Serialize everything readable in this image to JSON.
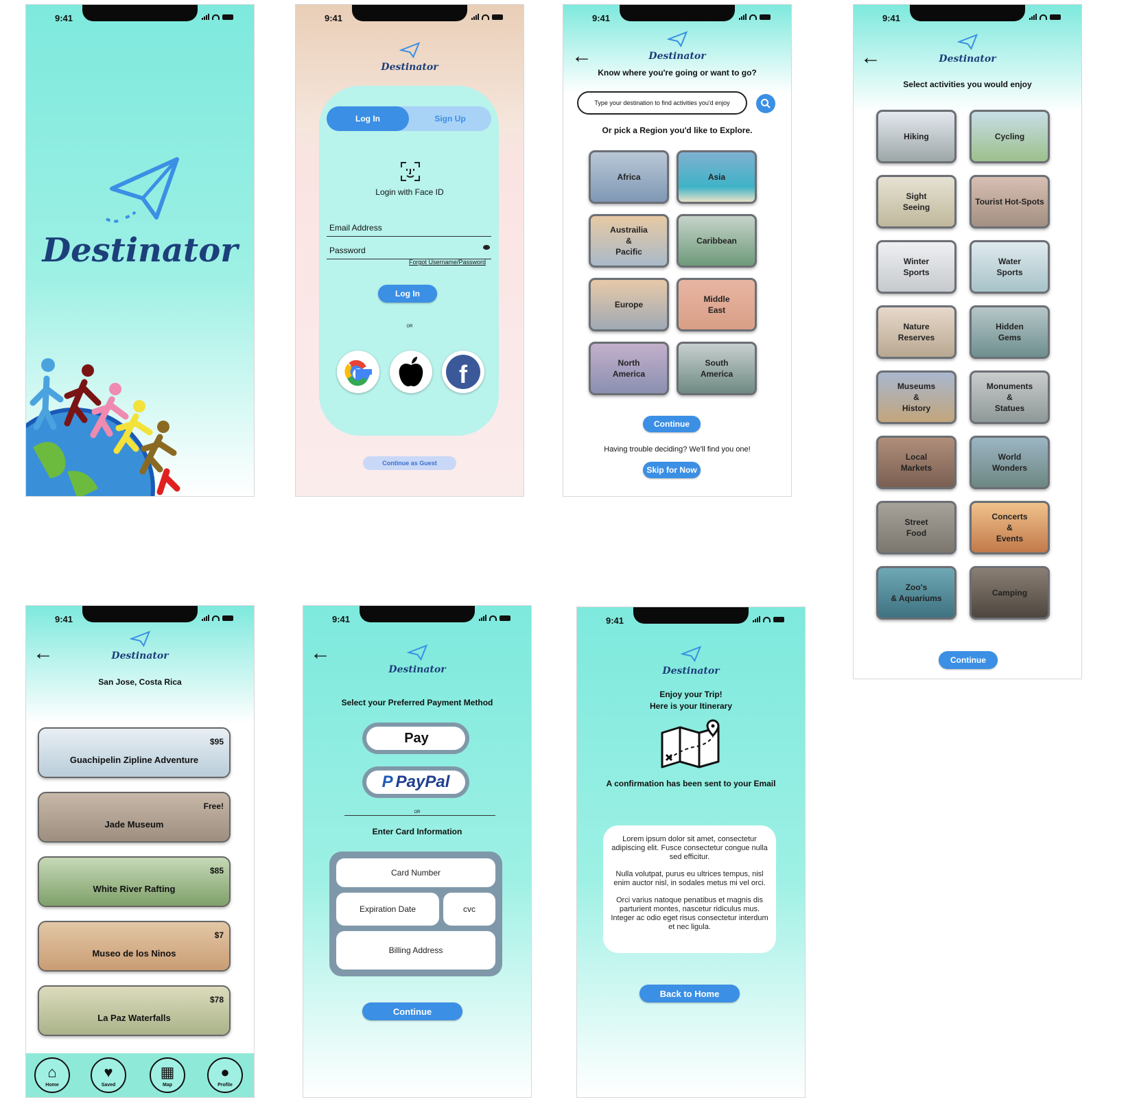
{
  "status": {
    "time": "9:41"
  },
  "brand": {
    "name": "Destinator",
    "accent": "#3b8fe4",
    "logo_color": "#1c3f7a"
  },
  "splash": {
    "illustration": "people-holding-hands-on-globe"
  },
  "login": {
    "tabs": [
      "Log In",
      "Sign Up"
    ],
    "face_id_label": "Login with Face ID",
    "email_label": "Email Address",
    "password_label": "Password",
    "forgot_link": "Forgot Username/Password",
    "login_button": "Log In",
    "or_text": "OR",
    "social_icons": [
      "google-icon",
      "apple-icon",
      "facebook-icon"
    ],
    "guest_button": "Continue as Guest"
  },
  "region": {
    "question": "Know where you're going or want to go?",
    "search_placeholder": "Type your destination to find activities you'd enjoy",
    "pick_text": "Or pick a Region you'd like to Explore.",
    "regions": [
      "Africa",
      "Asia",
      "Austrailia\n&\nPacific",
      "Caribbean",
      "Europe",
      "Middle\nEast",
      "North\nAmerica",
      "South\nAmerica"
    ],
    "continue_button": "Continue",
    "trouble_text": "Having trouble deciding? We'll find you one!",
    "skip_button": "Skip for Now"
  },
  "activities": {
    "title": "Select activities you would enjoy",
    "items": [
      "Hiking",
      "Cycling",
      "Sight\nSeeing",
      "Tourist Hot-Spots",
      "Winter\nSports",
      "Water\nSports",
      "Nature\nReserves",
      "Hidden\nGems",
      "Museums\n&\nHistory",
      "Monuments\n&\nStatues",
      "Local\nMarkets",
      "World\nWonders",
      "Street\nFood",
      "Concerts\n&\nEvents",
      "Zoo's\n& Aquariums",
      "Camping"
    ],
    "continue_button": "Continue"
  },
  "itinerary": {
    "location": "San Jose, Costa Rica",
    "items": [
      {
        "name": "Guachipelin Zipline Adventure",
        "price": "$95"
      },
      {
        "name": "Jade Museum",
        "price": "Free!"
      },
      {
        "name": "White River Rafting",
        "price": "$85"
      },
      {
        "name": "Museo de los Ninos",
        "price": "$7"
      },
      {
        "name": "La Paz Waterfalls",
        "price": "$78"
      }
    ],
    "nav": [
      "Home",
      "Saved",
      "Map",
      "Profile"
    ]
  },
  "payment": {
    "title": "Select your Preferred Payment Method",
    "apple_pay": "Pay",
    "paypal": "PayPal",
    "or_text": "OR",
    "card_title": "Enter Card Information",
    "card_number": "Card Number",
    "expiration": "Expiration Date",
    "cvc": "cvc",
    "billing": "Billing Address",
    "continue_button": "Continue"
  },
  "confirm": {
    "line1": "Enjoy your Trip!",
    "line2": "Here is your Itinerary",
    "email_text": "A confirmation has been sent to your Email",
    "p1": "Lorem ipsum dolor sit amet, consectetur adipiscing elit. Fusce consectetur congue nulla sed efficitur.",
    "p2": "Nulla volutpat, purus eu ultrices tempus, nisl enim auctor nisl, in sodales metus mi vel orci.",
    "p3": "Orci varius natoque penatibus et magnis dis parturient montes, nascetur ridiculus mus. Integer ac odio eget risus consectetur interdum et nec ligula.",
    "home_button": "Back to Home"
  }
}
